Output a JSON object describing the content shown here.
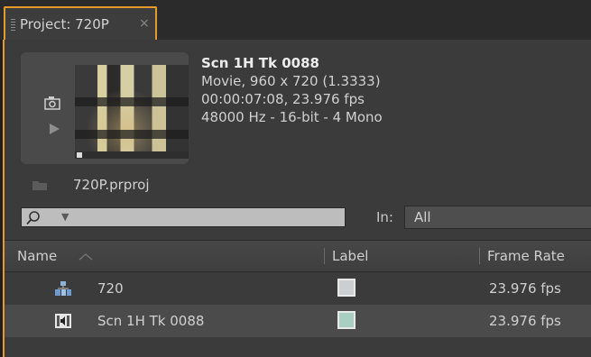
{
  "tab": {
    "title": "Project: 720P",
    "close": "×"
  },
  "clip": {
    "name": "Scn 1H Tk 0088",
    "type_info": "Movie, 960 x 720 (1.3333)",
    "timing": "00:00:07:08, 23.976 fps",
    "audio": "48000 Hz - 16-bit - 4 Mono"
  },
  "project": {
    "filename": "720P.prproj"
  },
  "search": {
    "value": ""
  },
  "filter": {
    "label": "In:",
    "value": "All"
  },
  "columns": {
    "name": "Name",
    "label": "Label",
    "frame_rate": "Frame Rate"
  },
  "rows": [
    {
      "name": "720",
      "label_color": "#c9d0cf",
      "frame_rate": "23.976 fps",
      "icon": "sequence-icon"
    },
    {
      "name": "Scn 1H Tk 0088",
      "label_color": "#a9cfc3",
      "frame_rate": "23.976 fps",
      "icon": "clip-audio-icon"
    }
  ],
  "colors": {
    "accent": "#e59a2c",
    "panel": "#3b3b3b",
    "selected_row": "#4b4b4b"
  }
}
